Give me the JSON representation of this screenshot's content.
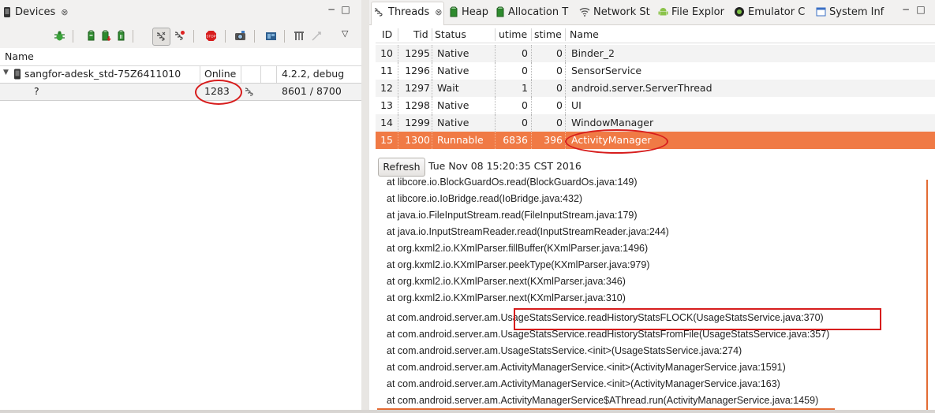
{
  "devices_view": {
    "tab_label": "Devices",
    "close_glyph": "⊗",
    "minimize_glyph": "−",
    "maximize_glyph": "□",
    "menu_glyph": "▽",
    "toolbar_icons": [
      "debug-bug-icon",
      "update-heap-icon",
      "dump-hprof-icon",
      "cause-gc-icon",
      "update-threads-icon",
      "start-method-profiling-icon",
      "stop-process-icon",
      "screen-capture-icon",
      "dump-view-hierarchy-icon",
      "systrace-icon",
      "opengl-trace-icon"
    ],
    "column_header": "Name",
    "device": {
      "name": "sangfor-adesk_std-75Z6411010",
      "state": "Online",
      "build": "4.2.2, debug"
    },
    "process": {
      "name": "?",
      "pid": "1283",
      "ports": "8601 / 8700"
    }
  },
  "threads_view": {
    "tabs": [
      {
        "label": "Threads",
        "icon": "threads-icon"
      },
      {
        "label": "Heap",
        "icon": "heap-icon"
      },
      {
        "label": "Allocation T",
        "icon": "allocation-icon"
      },
      {
        "label": "Network St",
        "icon": "wifi-icon"
      },
      {
        "label": "File Explor",
        "icon": "android-icon"
      },
      {
        "label": "Emulator C",
        "icon": "emulator-icon"
      },
      {
        "label": "System Inf",
        "icon": "window-icon"
      }
    ],
    "columns": [
      "ID",
      "Tid",
      "Status",
      "utime",
      "stime",
      "Name"
    ],
    "rows": [
      {
        "id": "10",
        "tid": "1295",
        "status": "Native",
        "utime": "0",
        "stime": "0",
        "name": "Binder_2"
      },
      {
        "id": "11",
        "tid": "1296",
        "status": "Native",
        "utime": "0",
        "stime": "0",
        "name": "SensorService"
      },
      {
        "id": "12",
        "tid": "1297",
        "status": "Wait",
        "utime": "1",
        "stime": "0",
        "name": "android.server.ServerThread"
      },
      {
        "id": "13",
        "tid": "1298",
        "status": "Native",
        "utime": "0",
        "stime": "0",
        "name": "UI"
      },
      {
        "id": "14",
        "tid": "1299",
        "status": "Native",
        "utime": "0",
        "stime": "0",
        "name": "WindowManager"
      },
      {
        "id": "15",
        "tid": "1300",
        "status": "Runnable",
        "utime": "6836",
        "stime": "396",
        "name": "ActivityManager"
      }
    ],
    "refresh_label": "Refresh",
    "refresh_time": "Tue Nov 08 15:20:35 CST 2016",
    "stack": [
      "at libcore.io.BlockGuardOs.read(BlockGuardOs.java:149)",
      "at libcore.io.IoBridge.read(IoBridge.java:432)",
      "at java.io.FileInputStream.read(FileInputStream.java:179)",
      "at java.io.InputStreamReader.read(InputStreamReader.java:244)",
      "at org.kxml2.io.KXmlParser.fillBuffer(KXmlParser.java:1496)",
      "at org.kxml2.io.KXmlParser.peekType(KXmlParser.java:979)",
      "at org.kxml2.io.KXmlParser.next(KXmlParser.java:346)",
      "at org.kxml2.io.KXmlParser.next(KXmlParser.java:310)",
      "at com.android.server.am.UsageStatsService.readHistoryStatsFLOCK(UsageStatsService.java:370)",
      "at com.android.server.am.UsageStatsService.readHistoryStatsFromFile(UsageStatsService.java:357)",
      "at com.android.server.am.UsageStatsService.<init>(UsageStatsService.java:274)",
      "at com.android.server.am.ActivityManagerService.<init>(ActivityManagerService.java:1591)",
      "at com.android.server.am.ActivityManagerService.<init>(ActivityManagerService.java:163)",
      "at com.android.server.am.ActivityManagerService$AThread.run(ActivityManagerService.java:1459)"
    ]
  },
  "colors": {
    "selection": "#f07a45",
    "annotation": "#d71d1d"
  }
}
